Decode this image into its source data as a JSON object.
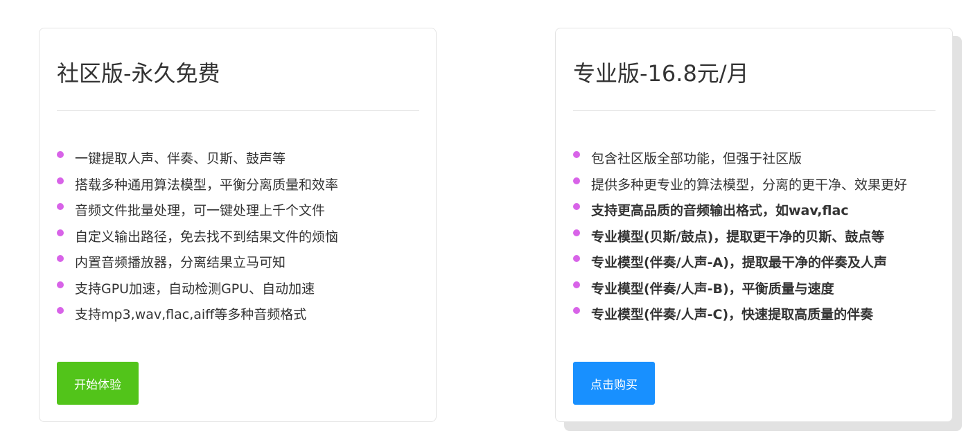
{
  "community": {
    "title": "社区版-永久免费",
    "features": [
      {
        "text": "一键提取人声、伴奏、贝斯、鼓声等",
        "bold": false
      },
      {
        "text": "搭载多种通用算法模型，平衡分离质量和效率",
        "bold": false
      },
      {
        "text": "音频文件批量处理，可一键处理上千个文件",
        "bold": false
      },
      {
        "text": "自定义输出路径，免去找不到结果文件的烦恼",
        "bold": false
      },
      {
        "text": "内置音频播放器，分离结果立马可知",
        "bold": false
      },
      {
        "text": "支持GPU加速，自动检测GPU、自动加速",
        "bold": false
      },
      {
        "text": "支持mp3,wav,flac,aiff等多种音频格式",
        "bold": false
      }
    ],
    "button_label": "开始体验"
  },
  "pro": {
    "title": "专业版-16.8元/月",
    "features": [
      {
        "text": "包含社区版全部功能，但强于社区版",
        "bold": false
      },
      {
        "text": "提供多种更专业的算法模型，分离的更干净、效果更好",
        "bold": false
      },
      {
        "text": "支持更高品质的音频输出格式，如wav,flac",
        "bold": true
      },
      {
        "text": "专业模型(贝斯/鼓点)，提取更干净的贝斯、鼓点等",
        "bold": true
      },
      {
        "text": "专业模型(伴奏/人声-A)，提取最干净的伴奏及人声",
        "bold": true
      },
      {
        "text": "专业模型(伴奏/人声-B)，平衡质量与速度",
        "bold": true
      },
      {
        "text": "专业模型(伴奏/人声-C)，快速提取高质量的伴奏",
        "bold": true
      }
    ],
    "button_label": "点击购买"
  },
  "colors": {
    "bullet": "#d863e8",
    "start_button": "#52c41a",
    "buy_button": "#1890ff"
  },
  "icons": {
    "bullet": "dot-icon"
  }
}
